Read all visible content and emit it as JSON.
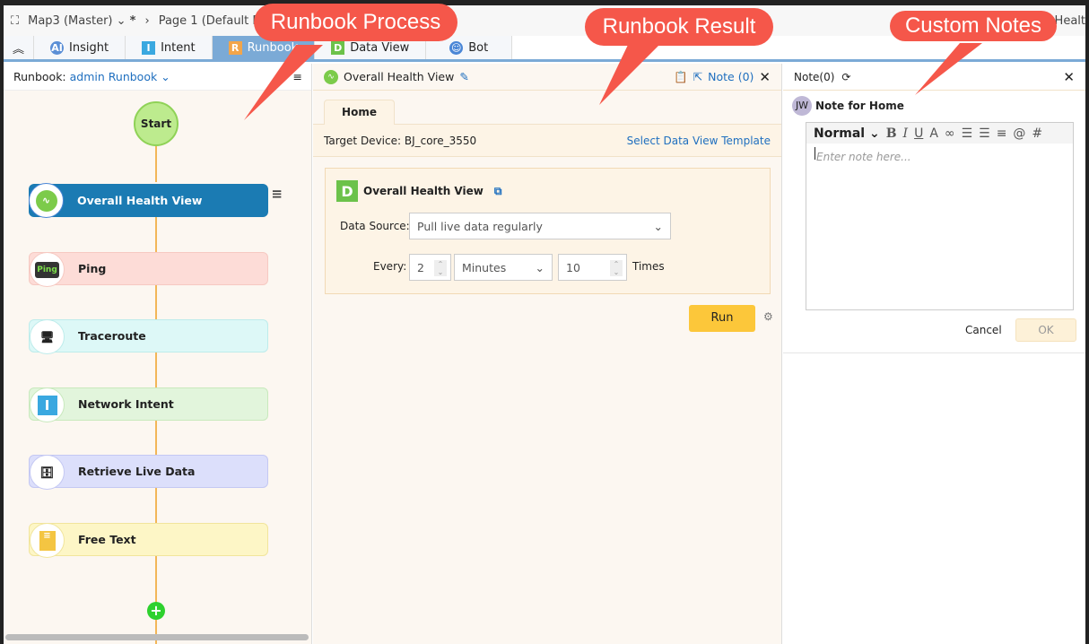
{
  "header": {
    "map": "Map3 (Master)",
    "modified": "*",
    "page": "Page 1  (Default Page)",
    "right_text": "Healt"
  },
  "tabs": [
    {
      "label": "Insight"
    },
    {
      "label": "Intent"
    },
    {
      "label": "Runbook"
    },
    {
      "label": "Data View"
    },
    {
      "label": "Bot"
    }
  ],
  "runbook": {
    "label": "Runbook:",
    "name": "admin Runbook",
    "start": "Start",
    "nodes": [
      {
        "label": "Overall Health View"
      },
      {
        "label": "Ping"
      },
      {
        "label": "Traceroute"
      },
      {
        "label": "Network Intent"
      },
      {
        "label": "Retrieve Live Data"
      },
      {
        "label": "Free Text"
      }
    ]
  },
  "result": {
    "title": "Overall Health View",
    "note": "Note (0)",
    "tab": "Home",
    "target": "Target Device: BJ_core_3550",
    "select_template": "Select Data View Template",
    "card_title": "Overall Health View",
    "data_source_label": "Data Source:",
    "data_source": "Pull live data regularly",
    "every_label": "Every:",
    "every_value": "2",
    "unit": "Minutes",
    "times_value": "10",
    "times_label": "Times",
    "run": "Run"
  },
  "notes": {
    "title": "Note(0)",
    "avatar": "JW",
    "heading": "Note for Home",
    "format": "Normal",
    "placeholder": "Enter note here...",
    "cancel": "Cancel",
    "ok": "OK"
  },
  "callouts": {
    "process": "Runbook Process",
    "result": "Runbook Result",
    "notes": "Custom Notes"
  }
}
